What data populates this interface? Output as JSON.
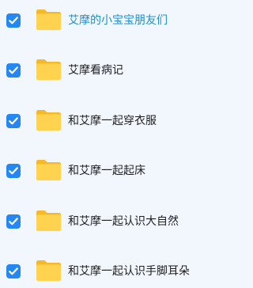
{
  "files": {
    "items": [
      {
        "label": "艾摩的小宝宝朋友们",
        "checked": true,
        "highlighted": true
      },
      {
        "label": "艾摩看病记",
        "checked": true,
        "highlighted": false
      },
      {
        "label": "和艾摩一起穿衣服",
        "checked": true,
        "highlighted": false
      },
      {
        "label": "和艾摩一起起床",
        "checked": true,
        "highlighted": false
      },
      {
        "label": "和艾摩一起认识大自然",
        "checked": true,
        "highlighted": false
      },
      {
        "label": "和艾摩一起认识手脚耳朵",
        "checked": true,
        "highlighted": false
      }
    ]
  },
  "icons": {
    "checkbox": "checkmark-icon",
    "folder": "folder-icon"
  },
  "colors": {
    "background": "#f2f7fd",
    "checkbox": "#2487f2",
    "folder_back": "#f6b92b",
    "folder_front": "#ffd34f",
    "highlight_text": "#1f8fd6",
    "text": "#1f1f1f"
  }
}
